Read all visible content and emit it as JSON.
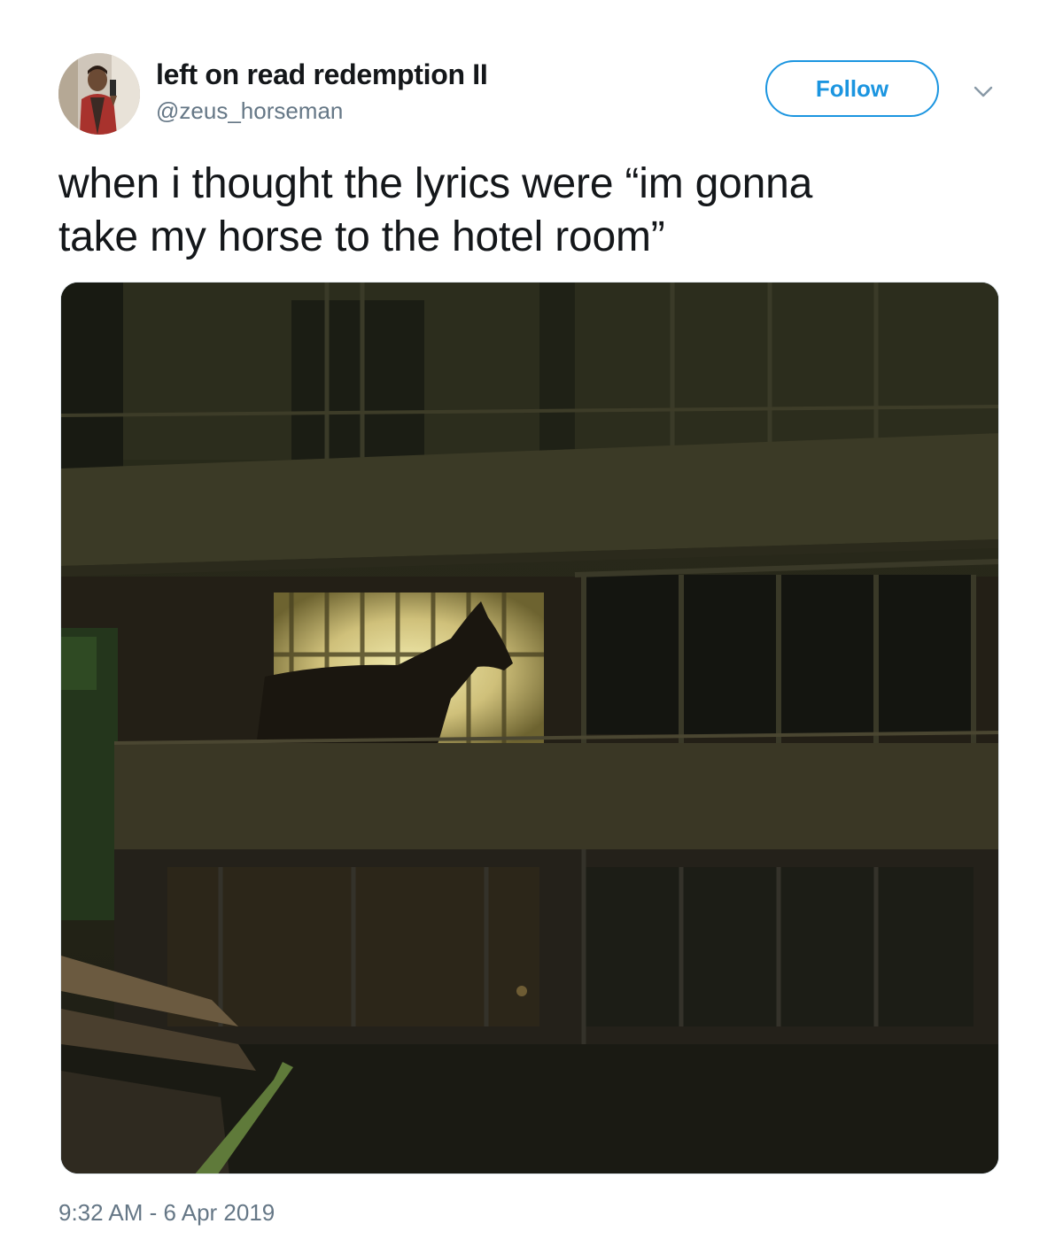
{
  "author": {
    "display_name": "left on read redemption II",
    "handle": "@zeus_horseman"
  },
  "follow_button": {
    "label": "Follow"
  },
  "tweet": {
    "text_lines": [
      "when i thought the lyrics were “im gonna",
      "take my horse to the hotel room”"
    ],
    "timestamp": "9:32 AM - 6 Apr 2019"
  },
  "colors": {
    "accent": "#1b95e0",
    "secondary_text": "#657786",
    "primary_text": "#14171a"
  },
  "icons": {
    "caret": "chevron-down-icon"
  }
}
